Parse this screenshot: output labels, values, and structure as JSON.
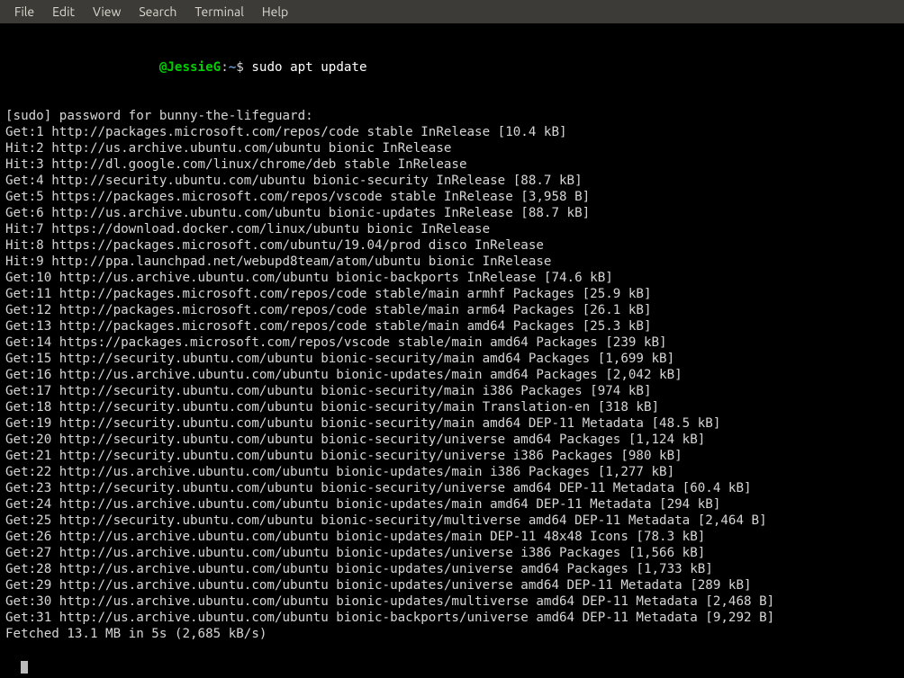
{
  "menubar": {
    "file": "File",
    "edit": "Edit",
    "view": "View",
    "search": "Search",
    "terminal": "Terminal",
    "help": "Help"
  },
  "prompt": {
    "user_host": "@JessieG",
    "sep": ":",
    "cwd": "~",
    "sigil": "$ ",
    "command": "sudo apt update"
  },
  "lines": [
    "[sudo] password for bunny-the-lifeguard:",
    "Get:1 http://packages.microsoft.com/repos/code stable InRelease [10.4 kB]",
    "Hit:2 http://us.archive.ubuntu.com/ubuntu bionic InRelease",
    "Hit:3 http://dl.google.com/linux/chrome/deb stable InRelease",
    "Get:4 http://security.ubuntu.com/ubuntu bionic-security InRelease [88.7 kB]",
    "Get:5 https://packages.microsoft.com/repos/vscode stable InRelease [3,958 B]",
    "Get:6 http://us.archive.ubuntu.com/ubuntu bionic-updates InRelease [88.7 kB]",
    "Hit:7 https://download.docker.com/linux/ubuntu bionic InRelease",
    "Hit:8 https://packages.microsoft.com/ubuntu/19.04/prod disco InRelease",
    "Hit:9 http://ppa.launchpad.net/webupd8team/atom/ubuntu bionic InRelease",
    "Get:10 http://us.archive.ubuntu.com/ubuntu bionic-backports InRelease [74.6 kB]",
    "Get:11 http://packages.microsoft.com/repos/code stable/main armhf Packages [25.9 kB]",
    "Get:12 http://packages.microsoft.com/repos/code stable/main arm64 Packages [26.1 kB]",
    "Get:13 http://packages.microsoft.com/repos/code stable/main amd64 Packages [25.3 kB]",
    "Get:14 https://packages.microsoft.com/repos/vscode stable/main amd64 Packages [239 kB]",
    "Get:15 http://security.ubuntu.com/ubuntu bionic-security/main amd64 Packages [1,699 kB]",
    "Get:16 http://us.archive.ubuntu.com/ubuntu bionic-updates/main amd64 Packages [2,042 kB]",
    "Get:17 http://security.ubuntu.com/ubuntu bionic-security/main i386 Packages [974 kB]",
    "Get:18 http://security.ubuntu.com/ubuntu bionic-security/main Translation-en [318 kB]",
    "Get:19 http://security.ubuntu.com/ubuntu bionic-security/main amd64 DEP-11 Metadata [48.5 kB]",
    "Get:20 http://security.ubuntu.com/ubuntu bionic-security/universe amd64 Packages [1,124 kB]",
    "Get:21 http://security.ubuntu.com/ubuntu bionic-security/universe i386 Packages [980 kB]",
    "Get:22 http://us.archive.ubuntu.com/ubuntu bionic-updates/main i386 Packages [1,277 kB]",
    "Get:23 http://security.ubuntu.com/ubuntu bionic-security/universe amd64 DEP-11 Metadata [60.4 kB]",
    "Get:24 http://us.archive.ubuntu.com/ubuntu bionic-updates/main amd64 DEP-11 Metadata [294 kB]",
    "Get:25 http://security.ubuntu.com/ubuntu bionic-security/multiverse amd64 DEP-11 Metadata [2,464 B]",
    "Get:26 http://us.archive.ubuntu.com/ubuntu bionic-updates/main DEP-11 48x48 Icons [78.3 kB]",
    "Get:27 http://us.archive.ubuntu.com/ubuntu bionic-updates/universe i386 Packages [1,566 kB]",
    "Get:28 http://us.archive.ubuntu.com/ubuntu bionic-updates/universe amd64 Packages [1,733 kB]",
    "Get:29 http://us.archive.ubuntu.com/ubuntu bionic-updates/universe amd64 DEP-11 Metadata [289 kB]",
    "Get:30 http://us.archive.ubuntu.com/ubuntu bionic-updates/multiverse amd64 DEP-11 Metadata [2,468 B]",
    "Get:31 http://us.archive.ubuntu.com/ubuntu bionic-backports/universe amd64 DEP-11 Metadata [9,292 B]",
    "Fetched 13.1 MB in 5s (2,685 kB/s)"
  ]
}
